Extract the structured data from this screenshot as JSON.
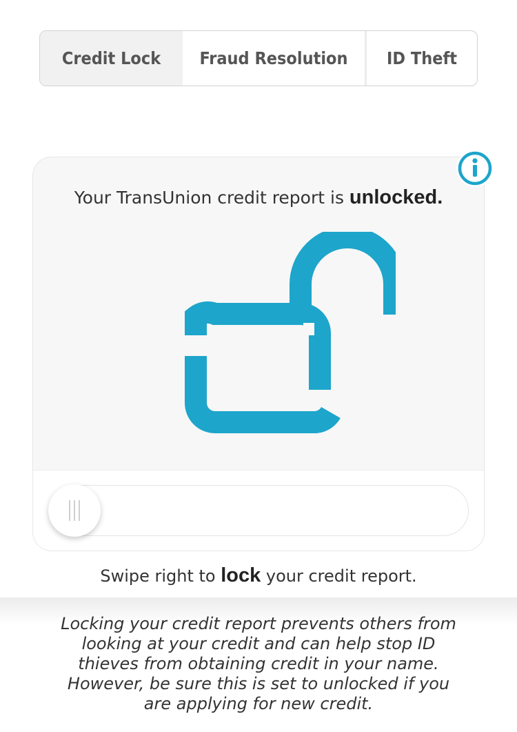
{
  "tabs": [
    {
      "label": "Credit Lock",
      "active": true
    },
    {
      "label": "Fraud Resolution",
      "active": false
    },
    {
      "label": "ID Theft",
      "active": false
    }
  ],
  "status": {
    "prefix": "Your TransUnion credit report is ",
    "state": "unlocked."
  },
  "info_icon": "info-icon",
  "lock_icon": "unlocked-padlock-icon",
  "slider": {
    "instruction_prefix": "Swipe right to ",
    "instruction_action": "lock",
    "instruction_suffix": " your credit report.",
    "locked": false
  },
  "note": "Locking your credit report prevents others from looking at your credit and can help stop ID thieves from obtaining credit in your name. However, be sure this is set to unlocked if you are applying for new credit.",
  "colors": {
    "accent": "#1DA5CB",
    "active_tab_bg": "#F1F1F1",
    "card_bg": "#F7F7F7"
  }
}
